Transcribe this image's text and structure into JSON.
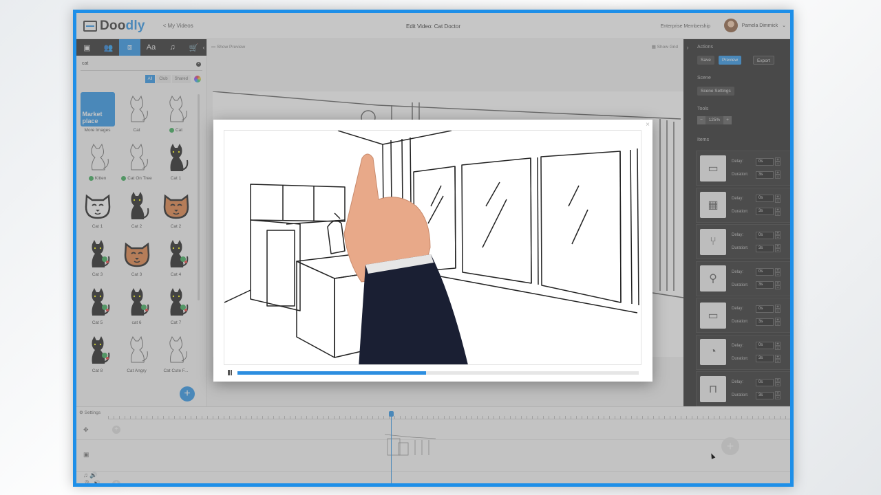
{
  "app": {
    "logo": "Doodly",
    "back_link": "< My Videos",
    "title": "Edit Video: Cat Doctor",
    "membership": "Enterprise Membership",
    "user_name": "Pamela Dimmick"
  },
  "left_panel": {
    "search_value": "cat",
    "filters": [
      "All",
      "Club",
      "Shared"
    ],
    "items": [
      {
        "label": "More Images",
        "kind": "marketplace",
        "text": "Market place"
      },
      {
        "label": "Cat",
        "kind": "sketch"
      },
      {
        "label": "Cat",
        "kind": "sketch",
        "badge": true
      },
      {
        "label": "Kitten",
        "kind": "sketch",
        "badge": true
      },
      {
        "label": "Cat On Tree",
        "kind": "sketch",
        "badge": true
      },
      {
        "label": "Cat 1",
        "kind": "black"
      },
      {
        "label": "Cat 1",
        "kind": "face"
      },
      {
        "label": "Cat 2",
        "kind": "black"
      },
      {
        "label": "Cat 2",
        "kind": "face-orange"
      },
      {
        "label": "Cat 3",
        "kind": "black-color"
      },
      {
        "label": "Cat 3",
        "kind": "face-orange"
      },
      {
        "label": "Cat 4",
        "kind": "black-color"
      },
      {
        "label": "Cat 5",
        "kind": "black-color"
      },
      {
        "label": "cat 6",
        "kind": "black-color"
      },
      {
        "label": "Cat 7",
        "kind": "black-color"
      },
      {
        "label": "Cat 8",
        "kind": "black-color"
      },
      {
        "label": "Cat Angry",
        "kind": "sketch"
      },
      {
        "label": "Cat Cute F...",
        "kind": "sketch"
      }
    ]
  },
  "canvas": {
    "show_preview": "Show Preview",
    "show_grid": "Show Grid"
  },
  "right_panel": {
    "actions_heading": "Actions",
    "save": "Save",
    "preview": "Preview",
    "export": "Export",
    "scene_heading": "Scene",
    "scene_settings": "Scene Settings",
    "tools_heading": "Tools",
    "zoom": "125%",
    "items_heading": "Items",
    "delay_label": "Delay:",
    "duration_label": "Duration:",
    "items": [
      {
        "delay": "0s",
        "duration": "3s"
      },
      {
        "delay": "0s",
        "duration": "3s"
      },
      {
        "delay": "0s",
        "duration": "3s"
      },
      {
        "delay": "0s",
        "duration": "3s"
      },
      {
        "delay": "0s",
        "duration": "3s"
      },
      {
        "delay": "0s",
        "duration": "3s"
      },
      {
        "delay": "0s",
        "duration": "3s"
      }
    ]
  },
  "timeline": {
    "settings": "Settings"
  },
  "preview_modal": {
    "progress": 0.47
  },
  "colors": {
    "accent": "#1e8fe8",
    "dark_panel": "#1c1c1c"
  }
}
